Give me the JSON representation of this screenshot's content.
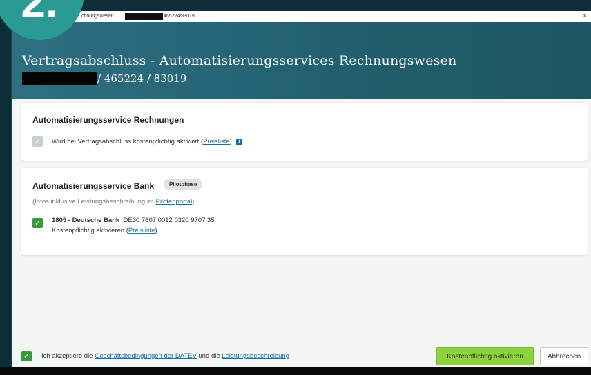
{
  "step_badge": "2.",
  "titlebar": {
    "text_left": "chnungswesen",
    "text_right": "465224/83019",
    "close": "×"
  },
  "header": {
    "title": "Vertragsabschluss - Automatisierungsservices Rechnungswesen",
    "subtitle": "/ 465224 / 83019"
  },
  "card_rechnungen": {
    "title": "Automatisierungsservice Rechnungen",
    "text": "Wird bei Vertragsabschluss kostenpflichtig aktiviert (",
    "link": "Preisliste",
    "text_end": ")",
    "info": "i",
    "checked": true,
    "disabled": true
  },
  "card_bank": {
    "title": "Automatisierungsservice Bank",
    "badge": "Pilotphase",
    "info_text": "(Infos inklusive Leistungsbeschreibung im ",
    "info_link": "Pilotenportal",
    "info_end": ")",
    "account": {
      "name": "1805 - Deutsche Bank",
      "iban": "DE30 7607 0012 0320 9707 35",
      "activate_text": "Kostenpflichtig aktivieren (",
      "activate_link": "Preisliste",
      "activate_end": ")",
      "checked": true
    }
  },
  "footer": {
    "accept_text": "Ich akzeptiere die ",
    "link1": "Geschäftsbedingungen der DATEV",
    "mid_text": " und die ",
    "link2": "Leistungsbeschreibung",
    "accept_checked": true,
    "primary_button": "Kostenpflichtig aktivieren",
    "cancel_button": "Abbrechen"
  },
  "colors": {
    "header_start": "#2e6f82",
    "header_end": "#1d5662",
    "accent_green": "#8fd33c",
    "check_green": "#3a9a38",
    "link": "#1c6e9e",
    "badge": "#2a9a95"
  }
}
